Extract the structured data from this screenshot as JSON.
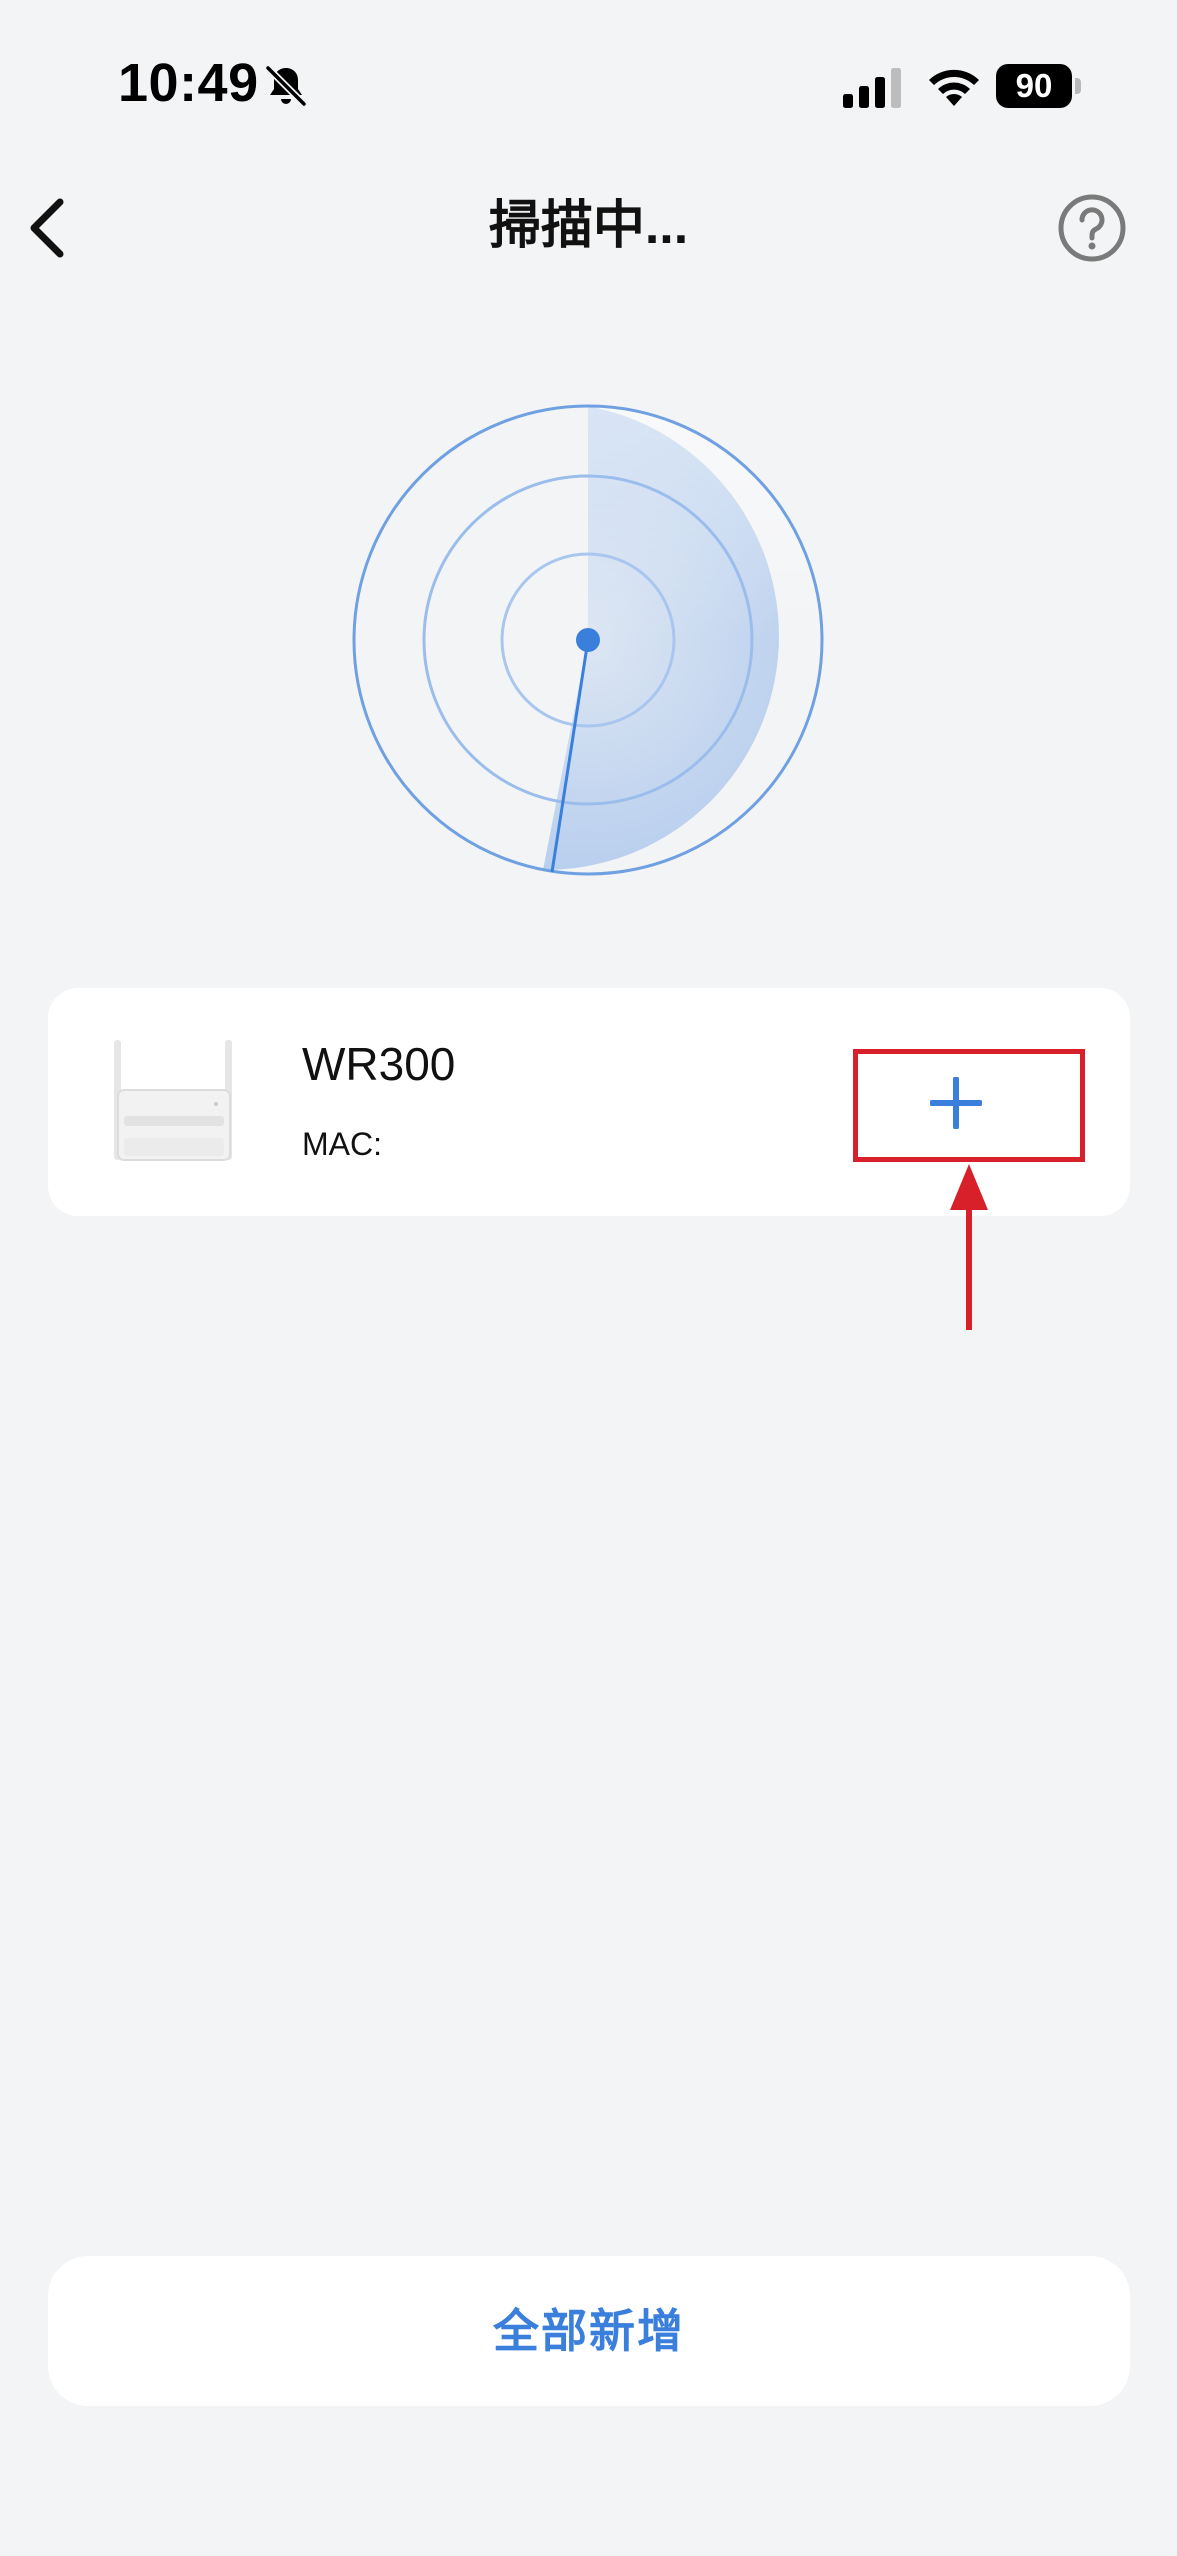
{
  "status_bar": {
    "time": "10:49",
    "battery_level": "90",
    "icons": [
      "bell-muted-icon",
      "cellular-signal-icon",
      "wifi-icon",
      "battery-icon"
    ]
  },
  "nav": {
    "title": "掃描中...",
    "back_icon": "chevron-left-icon",
    "help_icon": "question-circle-icon"
  },
  "radar": {
    "icon": "radar-scan-icon",
    "accent_color": "#3a7fdc",
    "ring_color": "#7aa8e6"
  },
  "device": {
    "name": "WR300",
    "mac_label": "MAC:",
    "image": "router-image",
    "add_icon": "plus-icon"
  },
  "annotation": {
    "color": "#d8202a",
    "shapes": [
      "highlight-box",
      "arrow-up"
    ]
  },
  "footer": {
    "add_all_label": "全部新增"
  },
  "colors": {
    "background": "#f3f4f6",
    "card": "#ffffff",
    "accent": "#3a7fdc"
  }
}
